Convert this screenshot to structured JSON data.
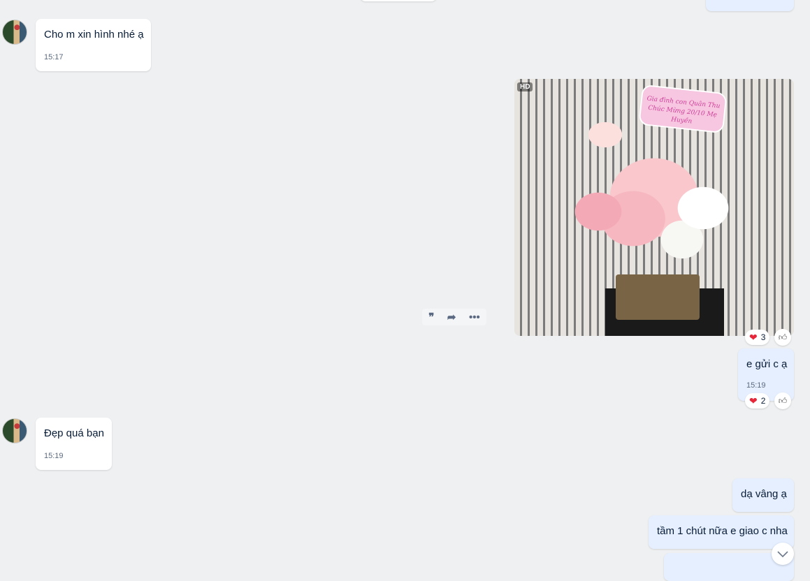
{
  "messages": [
    {
      "id": "m1",
      "side": "in",
      "text": "Cho m xin hình nhé ạ",
      "time": "15:17"
    },
    {
      "id": "m2",
      "side": "out",
      "type": "image",
      "badge": "HD",
      "sign_text": "Gia đình con Quân Thu Chúc Mừng 20/10 Mẹ Huyền",
      "reactions": {
        "heart": "3"
      }
    },
    {
      "id": "m3",
      "side": "out",
      "text": "e gửi c ạ",
      "time": "15:19",
      "reactions": {
        "heart": "2"
      }
    },
    {
      "id": "m4",
      "side": "in",
      "text": "Đẹp quá bạn",
      "time": "15:19"
    },
    {
      "id": "m5",
      "side": "out",
      "text": "dạ vâng ạ"
    },
    {
      "id": "m6",
      "side": "out",
      "text": "tầm 1 chút nữa e giao c nha"
    }
  ],
  "icons": {
    "quote": "quote-icon",
    "forward": "forward-icon",
    "more": "more-icon",
    "like": "thumbs-up-icon",
    "scroll": "chevron-down-icon"
  },
  "colors": {
    "background": "#eef0f1",
    "outgoing": "#e5efff",
    "incoming": "#ffffff"
  }
}
